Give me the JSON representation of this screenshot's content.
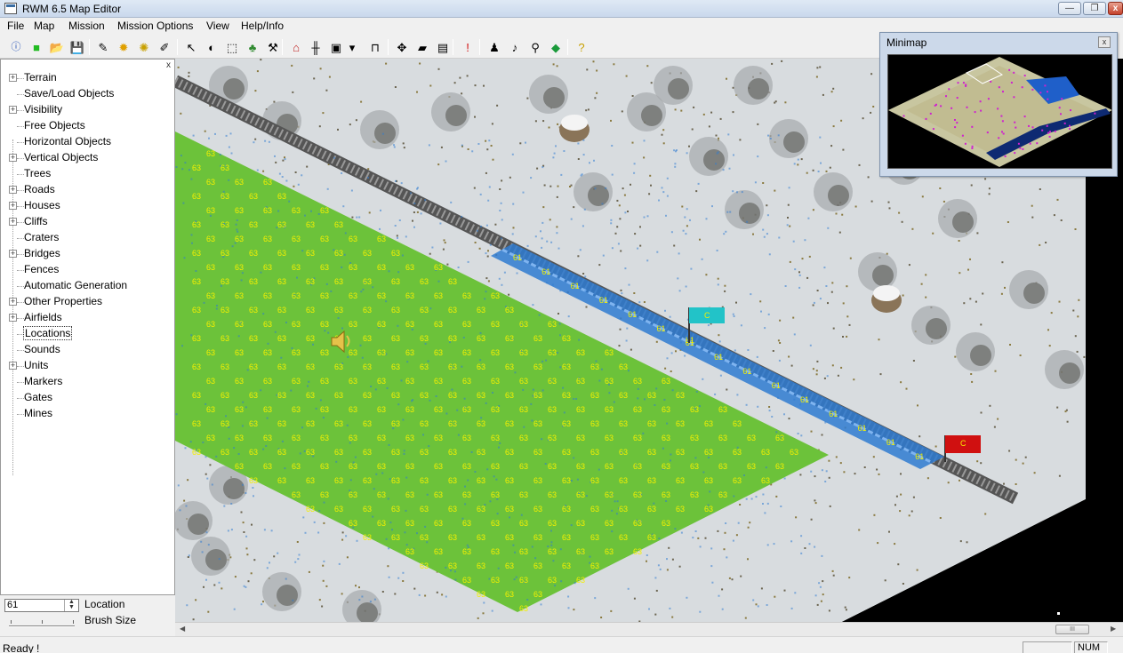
{
  "window": {
    "title": "RWM 6.5 Map Editor",
    "min_label": "—",
    "max_label": "❐",
    "close_label": "x"
  },
  "menu": [
    "File",
    "Map",
    "Mission",
    "Mission Options",
    "View",
    "Help/Info"
  ],
  "toolbar": {
    "icons": [
      "info-icon",
      "new-map-icon",
      "open-icon",
      "save-icon",
      "terrain-brush-icon",
      "sun-icon",
      "lights-icon",
      "eraser-icon",
      "pointer-icon",
      "fill-icon",
      "select-icon",
      "tree-icon",
      "tool-icon",
      "house-icon",
      "fence-icon",
      "vehicle-icon",
      "dropdown-icon",
      "bridge-icon",
      "move-icon",
      "folder-icon",
      "save-as-icon",
      "marker-icon",
      "unit-icon",
      "sound-icon",
      "zoom-icon",
      "diamond-icon",
      "help-icon"
    ],
    "info_text": "info"
  },
  "tree": {
    "close_label": "x",
    "items": [
      {
        "label": "Terrain",
        "expandable": true
      },
      {
        "label": "Save/Load Objects",
        "expandable": false
      },
      {
        "label": "Visibility",
        "expandable": true
      },
      {
        "label": "Free Objects",
        "expandable": false
      },
      {
        "label": "Horizontal Objects",
        "expandable": false
      },
      {
        "label": "Vertical Objects",
        "expandable": true
      },
      {
        "label": "Trees",
        "expandable": false
      },
      {
        "label": "Roads",
        "expandable": true
      },
      {
        "label": "Houses",
        "expandable": true
      },
      {
        "label": "Cliffs",
        "expandable": true
      },
      {
        "label": "Craters",
        "expandable": false
      },
      {
        "label": "Bridges",
        "expandable": true
      },
      {
        "label": "Fences",
        "expandable": false
      },
      {
        "label": "Automatic Generation",
        "expandable": false
      },
      {
        "label": "Other Properties",
        "expandable": true
      },
      {
        "label": "Airfields",
        "expandable": true
      },
      {
        "label": "Locations",
        "expandable": false,
        "selected": true
      },
      {
        "label": "Sounds",
        "expandable": false
      },
      {
        "label": "Units",
        "expandable": true
      },
      {
        "label": "Markers",
        "expandable": false
      },
      {
        "label": "Gates",
        "expandable": false
      },
      {
        "label": "Mines",
        "expandable": false
      }
    ]
  },
  "controls": {
    "location_value": "61",
    "location_label": "Location",
    "brush_label": "Brush Size",
    "brush_size_fraction": 0.1
  },
  "map": {
    "grass_location_id": "63",
    "rail_location_id": "61",
    "flag_cyan_label": "C",
    "flag_red_label": "C",
    "rail_tag": "L1",
    "colors": {
      "snow": "#d8dcdf",
      "grass": "#6cc23a",
      "rail_zone": "#2f7bd1",
      "flag_cyan": "#22c3c8",
      "flag_red": "#d01010"
    }
  },
  "minimap": {
    "title": "Minimap",
    "close_label": "x"
  },
  "hscroll": {
    "thumb_label": "III"
  },
  "status": {
    "text": "Ready !",
    "num": "NUM"
  }
}
